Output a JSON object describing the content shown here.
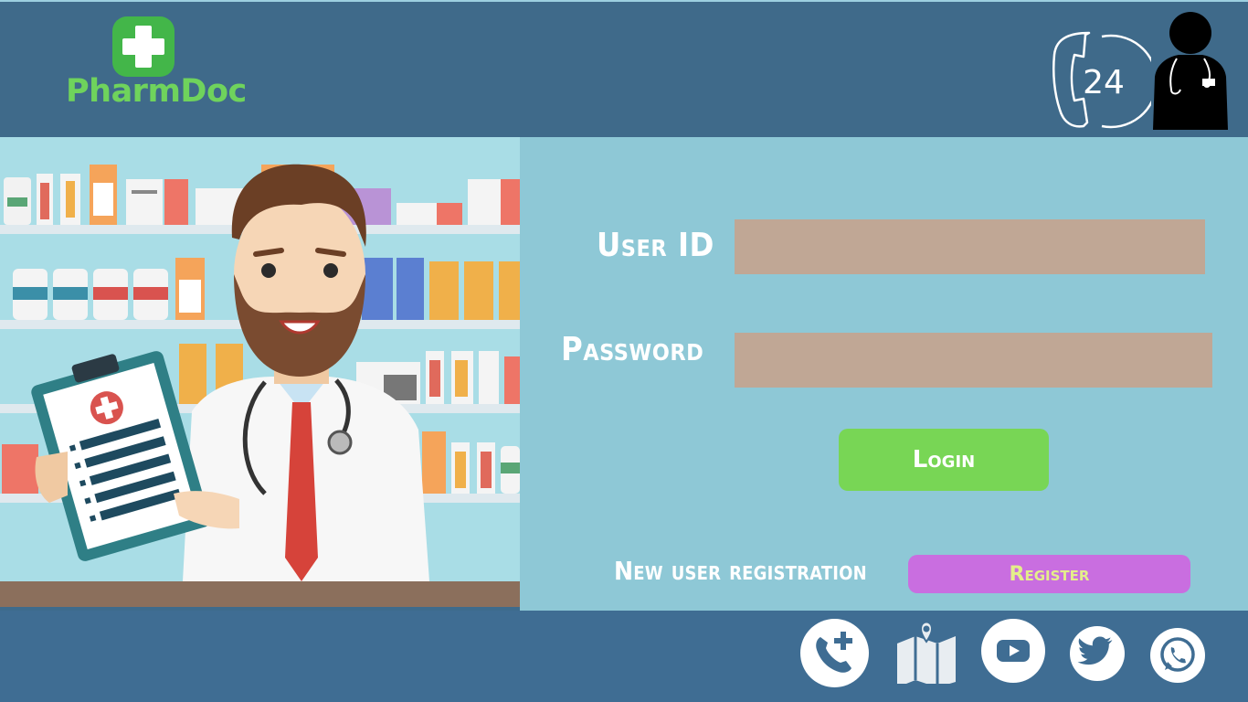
{
  "brand": {
    "name": "PharmDoc",
    "logo_icon": "medical-cross-icon",
    "color": "#6fd35c"
  },
  "header": {
    "support_badge": "24",
    "support_icon": "phone-24-icon",
    "doctor_icon": "doctor-avatar-icon"
  },
  "login": {
    "user_id_label": "User ID",
    "user_id_value": "",
    "password_label": "Password",
    "password_value": "",
    "login_button": "Login",
    "new_user_label": "New user registration",
    "register_button": "Register"
  },
  "footer": {
    "icons": [
      "phone-medical-icon",
      "map-location-icon",
      "youtube-icon",
      "twitter-icon",
      "whatsapp-icon"
    ]
  },
  "colors": {
    "header_bg": "#3f6a8a",
    "panel_bg": "#8ec8d6",
    "input_bg": "#c0a795",
    "login_bg": "#78d655",
    "register_bg": "#c96ee0",
    "register_text": "#e4ee8a"
  }
}
